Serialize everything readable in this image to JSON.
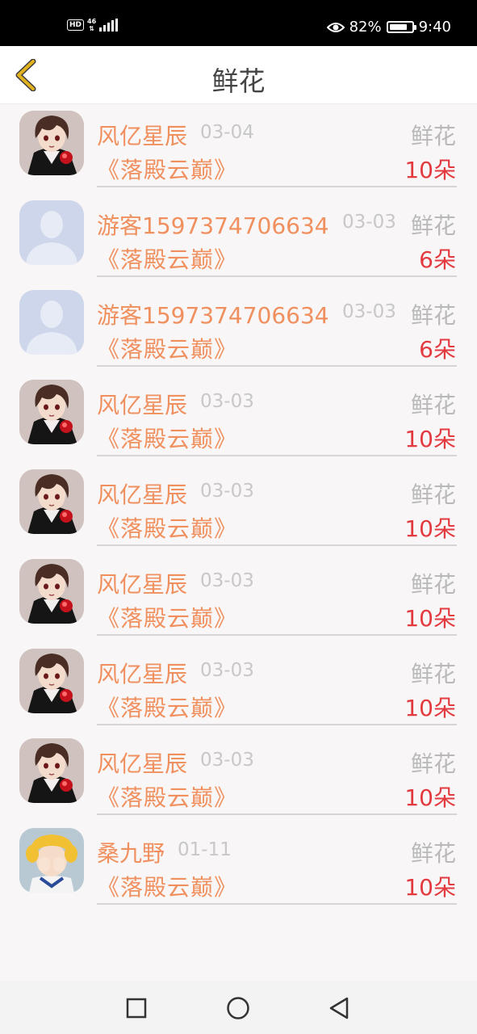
{
  "status_bar": {
    "hd": "HD",
    "network": "46",
    "battery_percent": "82%",
    "battery_level": 0.82,
    "time": "9:40",
    "icons": [
      "hd-icon",
      "signal-icon",
      "eye-icon",
      "battery-icon"
    ]
  },
  "header": {
    "title": "鲜花",
    "back_icon": "chevron-left-icon",
    "back_color": "#e0b020"
  },
  "colors": {
    "name": "#f0905f",
    "count": "#e33a3f",
    "muted": "#b9b9b9"
  },
  "records": [
    {
      "name": "风亿星辰",
      "date": "03-04",
      "gift": "鲜花",
      "book": "《落殿云巅》",
      "count": "10朵",
      "avatar": "anime-boy"
    },
    {
      "name": "游客1597374706634",
      "date": "03-03",
      "gift": "鲜花",
      "book": "《落殿云巅》",
      "count": "6朵",
      "avatar": "default-user"
    },
    {
      "name": "游客1597374706634",
      "date": "03-03",
      "gift": "鲜花",
      "book": "《落殿云巅》",
      "count": "6朵",
      "avatar": "default-user"
    },
    {
      "name": "风亿星辰",
      "date": "03-03",
      "gift": "鲜花",
      "book": "《落殿云巅》",
      "count": "10朵",
      "avatar": "anime-boy"
    },
    {
      "name": "风亿星辰",
      "date": "03-03",
      "gift": "鲜花",
      "book": "《落殿云巅》",
      "count": "10朵",
      "avatar": "anime-boy"
    },
    {
      "name": "风亿星辰",
      "date": "03-03",
      "gift": "鲜花",
      "book": "《落殿云巅》",
      "count": "10朵",
      "avatar": "anime-boy"
    },
    {
      "name": "风亿星辰",
      "date": "03-03",
      "gift": "鲜花",
      "book": "《落殿云巅》",
      "count": "10朵",
      "avatar": "anime-boy"
    },
    {
      "name": "风亿星辰",
      "date": "03-03",
      "gift": "鲜花",
      "book": "《落殿云巅》",
      "count": "10朵",
      "avatar": "anime-boy"
    },
    {
      "name": "桑九野",
      "date": "01-11",
      "gift": "鲜花",
      "book": "《落殿云巅》",
      "count": "10朵",
      "avatar": "anime-girl"
    }
  ],
  "nav_bar": {
    "icons": [
      "recent-apps-icon",
      "home-icon",
      "back-icon"
    ]
  }
}
